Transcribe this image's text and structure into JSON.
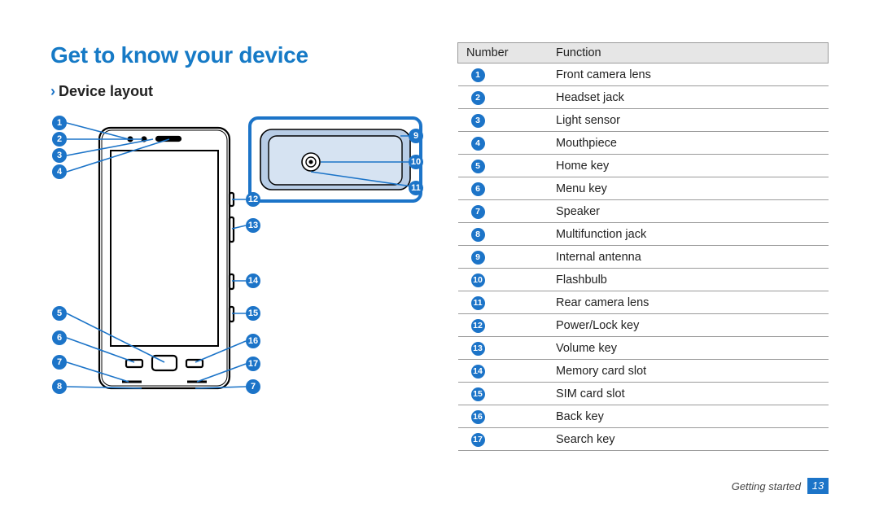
{
  "title": "Get to know your device",
  "subhead": "Device layout",
  "table": {
    "header": {
      "col1": "Number",
      "col2": "Function"
    },
    "rows": [
      {
        "n": "1",
        "fn": "Front camera lens"
      },
      {
        "n": "2",
        "fn": "Headset jack"
      },
      {
        "n": "3",
        "fn": "Light sensor"
      },
      {
        "n": "4",
        "fn": "Mouthpiece"
      },
      {
        "n": "5",
        "fn": "Home key"
      },
      {
        "n": "6",
        "fn": "Menu key"
      },
      {
        "n": "7",
        "fn": "Speaker"
      },
      {
        "n": "8",
        "fn": "Multifunction jack"
      },
      {
        "n": "9",
        "fn": "Internal antenna"
      },
      {
        "n": "10",
        "fn": "Flashbulb"
      },
      {
        "n": "11",
        "fn": "Rear camera lens"
      },
      {
        "n": "12",
        "fn": "Power/Lock key"
      },
      {
        "n": "13",
        "fn": "Volume key"
      },
      {
        "n": "14",
        "fn": "Memory card slot"
      },
      {
        "n": "15",
        "fn": "SIM card slot"
      },
      {
        "n": "16",
        "fn": "Back key"
      },
      {
        "n": "17",
        "fn": "Search key"
      }
    ]
  },
  "diagram_labels": {
    "l1": "1",
    "l2": "2",
    "l3": "3",
    "l4": "4",
    "l5": "5",
    "l6": "6",
    "l7": "7",
    "l8": "8",
    "r9": "9",
    "r10": "10",
    "r11": "11",
    "r12": "12",
    "r13": "13",
    "r14": "14",
    "r15": "15",
    "r16": "16",
    "r17": "17",
    "r7b": "7"
  },
  "footer": {
    "section": "Getting started",
    "page": "13"
  }
}
